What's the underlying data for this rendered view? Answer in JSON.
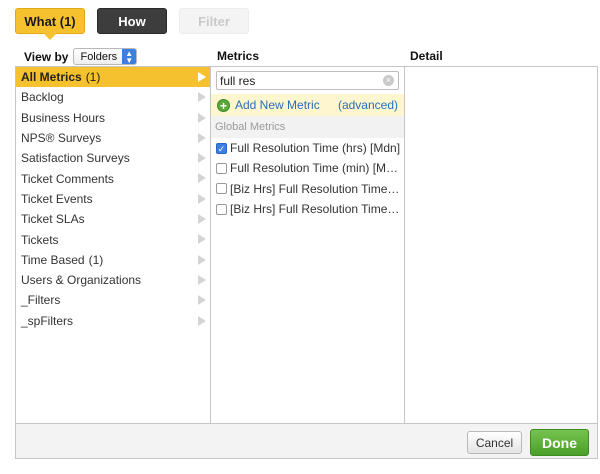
{
  "tabs": [
    {
      "label": "What (1)",
      "state": "active"
    },
    {
      "label": "How",
      "state": "normal"
    },
    {
      "label": "Filter",
      "state": "disabled"
    }
  ],
  "header": {
    "view_by_label": "View by",
    "view_by_value": "Folders",
    "metrics_label": "Metrics",
    "detail_label": "Detail"
  },
  "categories": [
    {
      "label": "All Metrics",
      "count": "(1)",
      "selected": true
    },
    {
      "label": "Backlog",
      "count": ""
    },
    {
      "label": "Business Hours",
      "count": ""
    },
    {
      "label": "NPS® Surveys",
      "count": ""
    },
    {
      "label": "Satisfaction Surveys",
      "count": ""
    },
    {
      "label": "Ticket Comments",
      "count": ""
    },
    {
      "label": "Ticket Events",
      "count": ""
    },
    {
      "label": "Ticket SLAs",
      "count": ""
    },
    {
      "label": "Tickets",
      "count": ""
    },
    {
      "label": "Time Based",
      "count": "(1)"
    },
    {
      "label": "Users & Organizations",
      "count": ""
    },
    {
      "label": "_Filters",
      "count": ""
    },
    {
      "label": "_spFilters",
      "count": ""
    }
  ],
  "metrics": {
    "search_value": "full res",
    "add_new_label": "Add New Metric",
    "advanced_label": "(advanced)",
    "section_title": "Global Metrics",
    "items": [
      {
        "label": "Full Resolution Time (hrs) [Mdn]",
        "checked": true
      },
      {
        "label": "Full Resolution Time (min) [Mdn]",
        "checked": false
      },
      {
        "label": "[Biz Hrs] Full Resolution Time (...",
        "checked": false
      },
      {
        "label": "[Biz Hrs] Full Resolution Time (...",
        "checked": false
      }
    ]
  },
  "footer": {
    "cancel_label": "Cancel",
    "done_label": "Done"
  },
  "colors": {
    "accent_yellow": "#f6c12e",
    "how_tab_dark": "#3d3d3d",
    "done_green": "#4a9f2a",
    "link_blue": "#2a6fb8"
  }
}
